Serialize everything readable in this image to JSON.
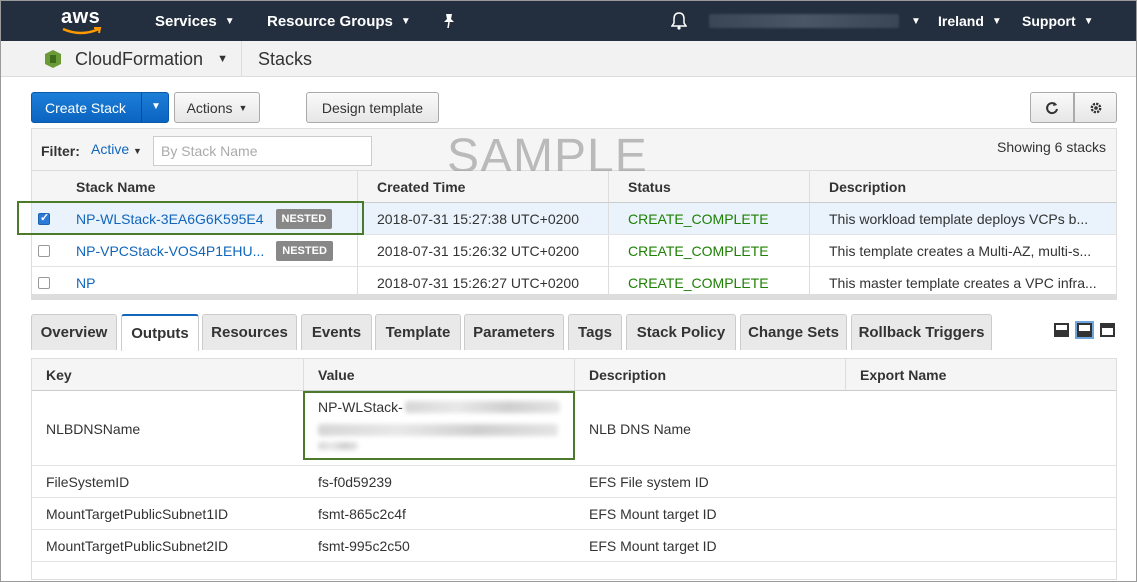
{
  "topnav": {
    "logo_text": "aws",
    "services": "Services",
    "resource_groups": "Resource Groups",
    "region": "Ireland",
    "support": "Support"
  },
  "service": {
    "name": "CloudFormation",
    "page": "Stacks"
  },
  "toolbar": {
    "create_stack": "Create Stack",
    "actions": "Actions",
    "design_template": "Design template"
  },
  "filter": {
    "label": "Filter:",
    "active": "Active",
    "placeholder": "By Stack Name",
    "watermark": "SAMPLE",
    "showing": "Showing 6 stacks"
  },
  "stacks": {
    "headers": [
      "Stack Name",
      "Created Time",
      "Status",
      "Description"
    ],
    "rows": [
      {
        "name": "NP-WLStack-3EA6G6K595E4",
        "badge": "NESTED",
        "created": "2018-07-31 15:27:38 UTC+0200",
        "status": "CREATE_COMPLETE",
        "description": "This workload template deploys VCPs b...",
        "selected": true
      },
      {
        "name": "NP-VPCStack-VOS4P1EHU...",
        "badge": "NESTED",
        "created": "2018-07-31 15:26:32 UTC+0200",
        "status": "CREATE_COMPLETE",
        "description": "This template creates a Multi-AZ, multi-s...",
        "selected": false
      },
      {
        "name": "NP",
        "badge": "",
        "created": "2018-07-31 15:26:27 UTC+0200",
        "status": "CREATE_COMPLETE",
        "description": "This master template creates a VPC infra...",
        "selected": false
      }
    ]
  },
  "tabs": [
    "Overview",
    "Outputs",
    "Resources",
    "Events",
    "Template",
    "Parameters",
    "Tags",
    "Stack Policy",
    "Change Sets",
    "Rollback Triggers"
  ],
  "active_tab": "Outputs",
  "outputs": {
    "headers": [
      "Key",
      "Value",
      "Description",
      "Export Name"
    ],
    "rows": [
      {
        "key": "NLBDNSName",
        "value": "NP-WLStack-",
        "description": "NLB DNS Name",
        "export": ""
      },
      {
        "key": "FileSystemID",
        "value": "fs-f0d59239",
        "description": "EFS File system ID",
        "export": ""
      },
      {
        "key": "MountTargetPublicSubnet1ID",
        "value": "fsmt-865c2c4f",
        "description": "EFS Mount target ID",
        "export": ""
      },
      {
        "key": "MountTargetPublicSubnet2ID",
        "value": "fsmt-995c2c50",
        "description": "EFS Mount target ID",
        "export": ""
      }
    ]
  },
  "colors": {
    "nav_bg": "#232f3e",
    "primary": "#0a64c0",
    "link": "#1166bb",
    "status_ok": "#1d8102",
    "highlight": "#4a7a2a"
  }
}
